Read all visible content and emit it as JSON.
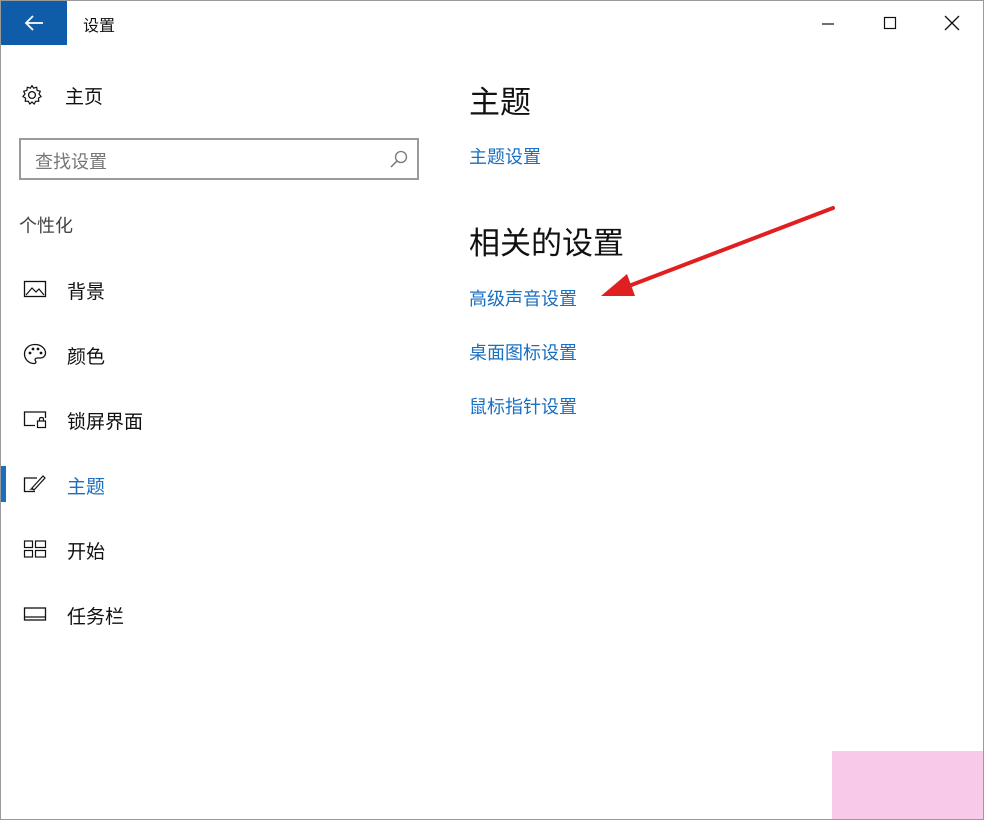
{
  "window": {
    "title": "设置"
  },
  "sidebar": {
    "home_label": "主页",
    "search": {
      "placeholder": "查找设置"
    },
    "section_label": "个性化",
    "items": [
      {
        "label": "背景",
        "icon": "picture-icon",
        "active": false
      },
      {
        "label": "颜色",
        "icon": "palette-icon",
        "active": false
      },
      {
        "label": "锁屏界面",
        "icon": "lock-screen-icon",
        "active": false
      },
      {
        "label": "主题",
        "icon": "theme-brush-icon",
        "active": true
      },
      {
        "label": "开始",
        "icon": "start-tiles-icon",
        "active": false
      },
      {
        "label": "任务栏",
        "icon": "taskbar-icon",
        "active": false
      }
    ]
  },
  "main": {
    "title": "主题",
    "theme_settings_link": "主题设置",
    "related_title": "相关的设置",
    "related_links": [
      "高级声音设置",
      "桌面图标设置",
      "鼠标指针设置"
    ]
  },
  "colors": {
    "accent": "#1a6fc0",
    "back_button": "#0f5ca8",
    "annotation_arrow": "#e02020",
    "corner_block": "#f8c9e8"
  }
}
